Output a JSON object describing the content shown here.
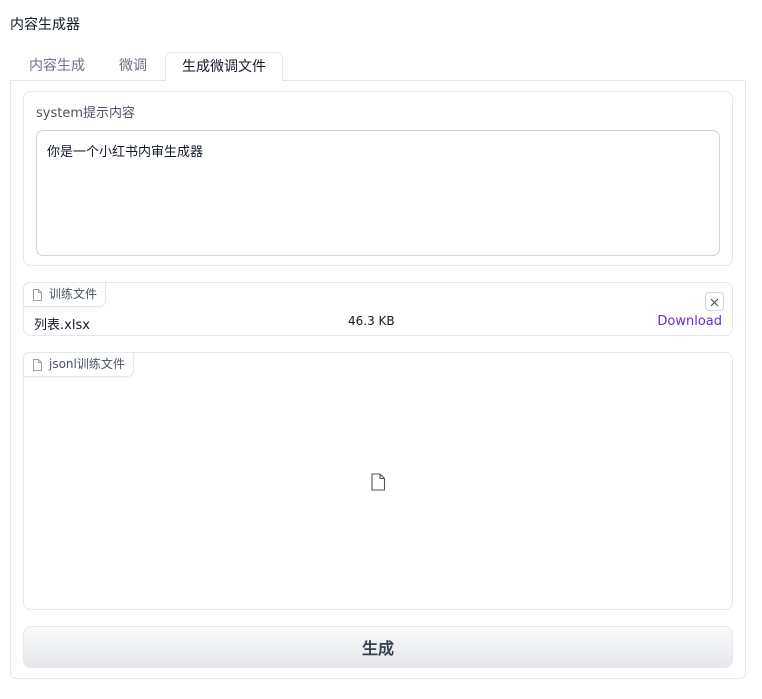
{
  "app": {
    "title": "内容生成器"
  },
  "tabs": [
    {
      "label": "内容生成"
    },
    {
      "label": "微调"
    },
    {
      "label": "生成微调文件"
    }
  ],
  "system_prompt": {
    "label": "system提示内容",
    "value": "你是一个小红书内审生成器"
  },
  "training_file": {
    "label": "训练文件",
    "icon": "file-icon",
    "file_name": "列表.xlsx",
    "file_size": "46.3 KB",
    "download_label": "Download",
    "clear_icon": "close-icon"
  },
  "jsonl_file": {
    "label": "jsonl训练文件",
    "icon": "file-icon",
    "empty_icon": "file-icon"
  },
  "generate_button": {
    "label": "生成"
  },
  "colors": {
    "accent_link": "#6d28d9",
    "border": "#e5e7eb",
    "text": "#111827",
    "muted": "#6b7280"
  }
}
